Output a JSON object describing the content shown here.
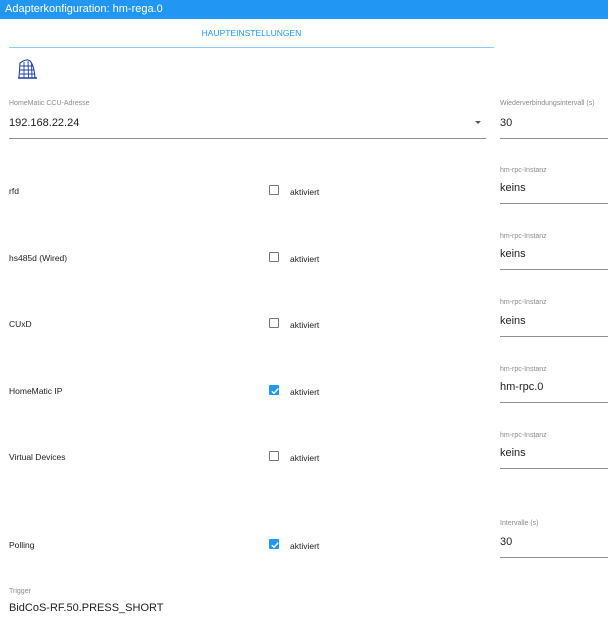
{
  "window": {
    "title": "Adapterkonfiguration: hm-rega.0"
  },
  "tabs": [
    {
      "label": "HAUPTEINSTELLUNGEN",
      "active": true
    }
  ],
  "icons": {
    "logo": "homematic-tower-icon"
  },
  "ccu": {
    "label": "HomeMatic CCU-Adresse",
    "value": "192.168.22.24"
  },
  "reconnect": {
    "label": "Wiederverbindungsintervall (s)",
    "value": "30"
  },
  "rows": [
    {
      "label": "rfd",
      "checked": false,
      "check_label": "aktiviert",
      "instance_label": "hm-rpc-Instanz",
      "instance_value": "keins"
    },
    {
      "label": "hs485d (Wired)",
      "checked": false,
      "check_label": "aktiviert",
      "instance_label": "hm-rpc-Instanz",
      "instance_value": "keins"
    },
    {
      "label": "CUxD",
      "checked": false,
      "check_label": "aktiviert",
      "instance_label": "hm-rpc-Instanz",
      "instance_value": "keins"
    },
    {
      "label": "HomeMatic IP",
      "checked": true,
      "check_label": "aktiviert",
      "instance_label": "hm-rpc-Instanz",
      "instance_value": "hm-rpc.0"
    },
    {
      "label": "Virtual Devices",
      "checked": false,
      "check_label": "aktiviert",
      "instance_label": "hm-rpc-Instanz",
      "instance_value": "keins"
    }
  ],
  "polling": {
    "label": "Polling",
    "checked": true,
    "check_label": "aktiviert",
    "interval_label": "Intervalle (s)",
    "interval_value": "30"
  },
  "trigger": {
    "label": "Trigger",
    "value": "BidCoS-RF.50.PRESS_SHORT"
  },
  "colors": {
    "accent": "#2196f3",
    "checkbox_border": "#757575",
    "underline": "#8f8f8f"
  }
}
